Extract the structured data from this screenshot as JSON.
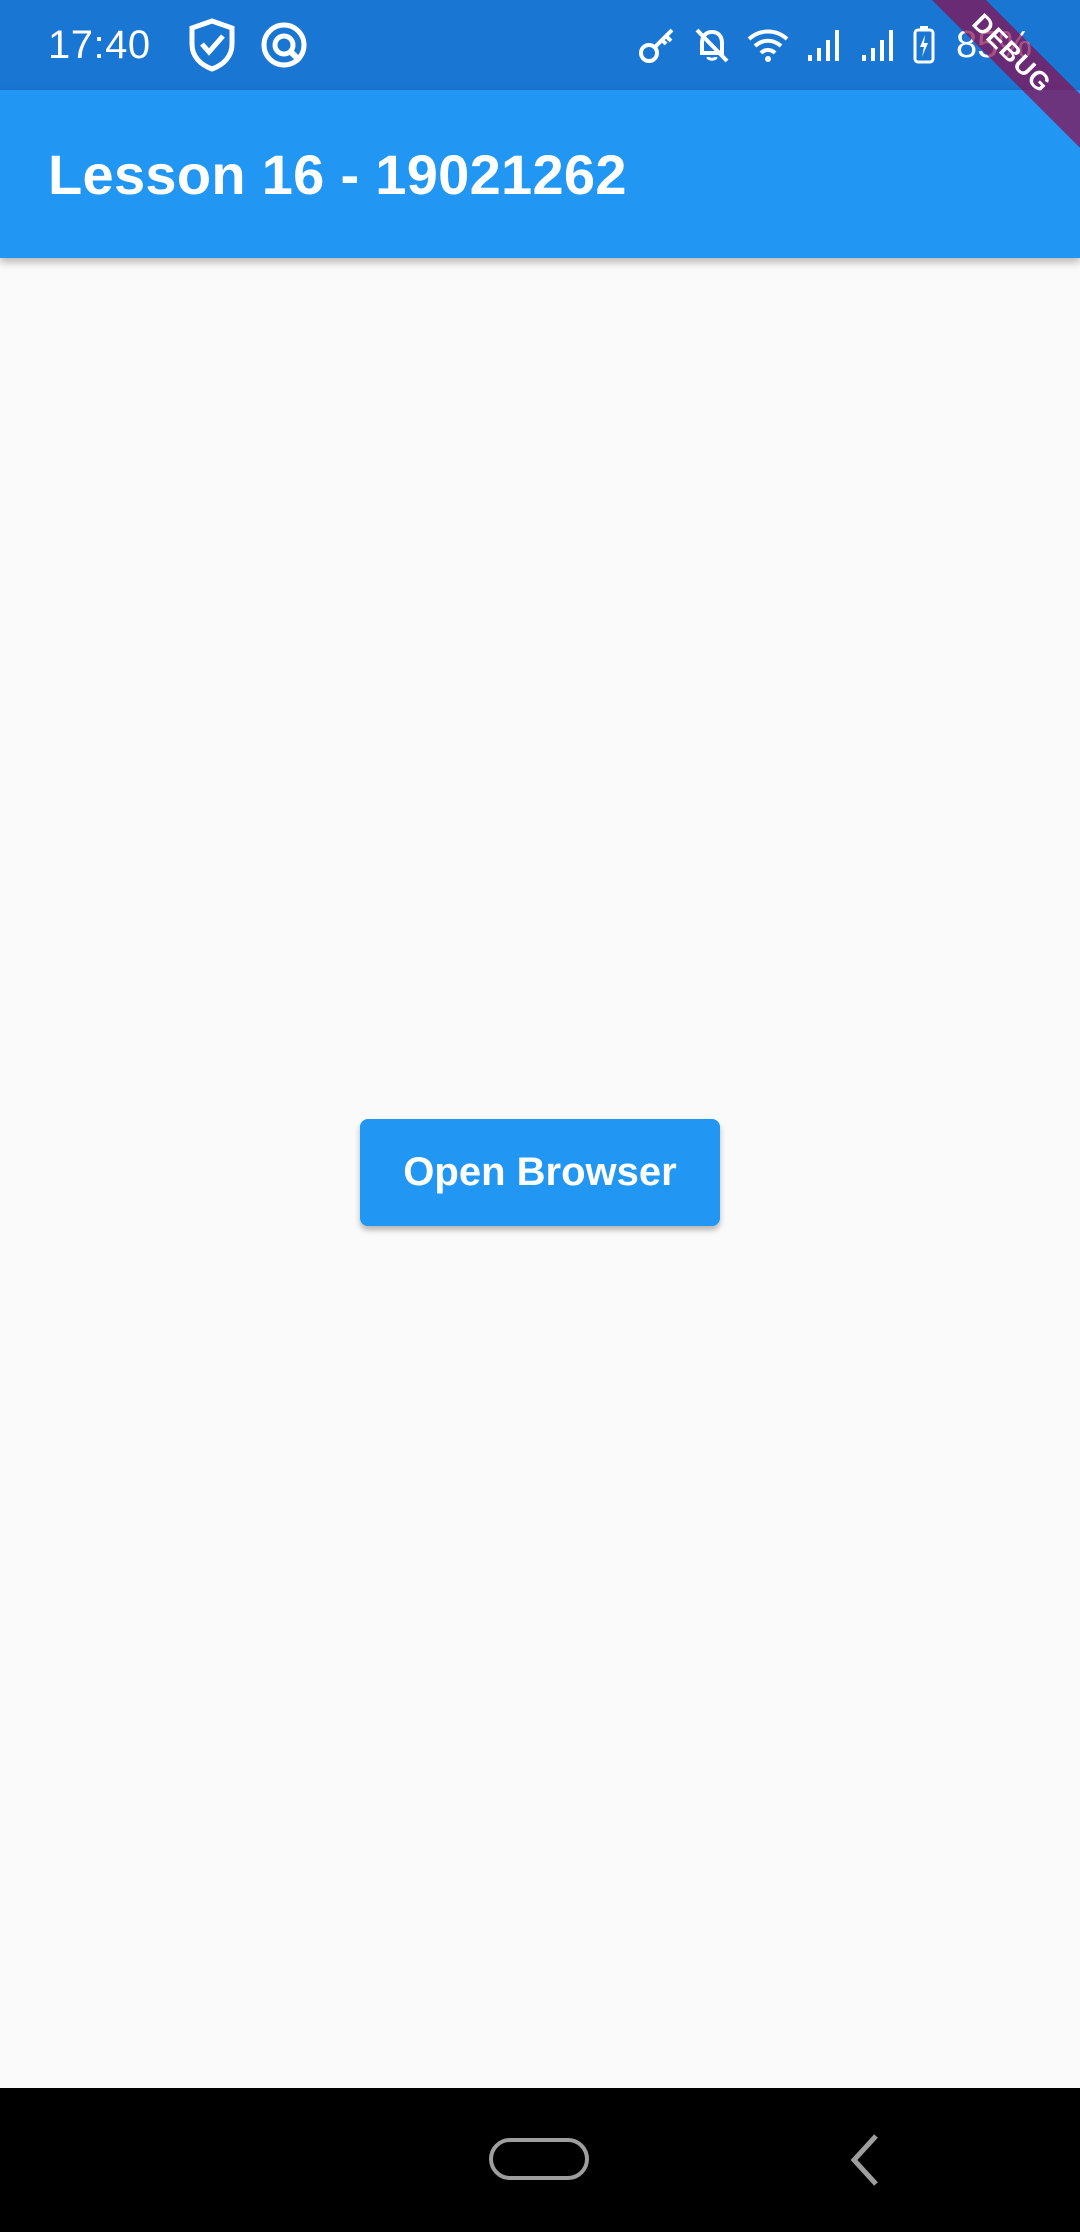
{
  "status_bar": {
    "time": "17:40",
    "left_icons": [
      "shield-check-icon",
      "app-circle-icon"
    ],
    "right_icons": [
      "vpn-key-icon",
      "bell-off-icon",
      "wifi-icon",
      "signal-1-icon",
      "signal-2-icon",
      "battery-charging-icon"
    ],
    "battery": "85%"
  },
  "app_bar": {
    "title": "Lesson 16 - 19021262"
  },
  "debug_banner": {
    "label": "DEBUG"
  },
  "main": {
    "open_button_label": "Open Browser"
  },
  "nav_bar": {
    "buttons": [
      "home-pill",
      "back-chevron"
    ]
  },
  "colors": {
    "status_bar": "#1976d2",
    "app_bar": "#2196f3",
    "button": "#2196f3",
    "background": "#fafafa",
    "debug_banner": "#880e4f",
    "nav_bar": "#000000"
  }
}
